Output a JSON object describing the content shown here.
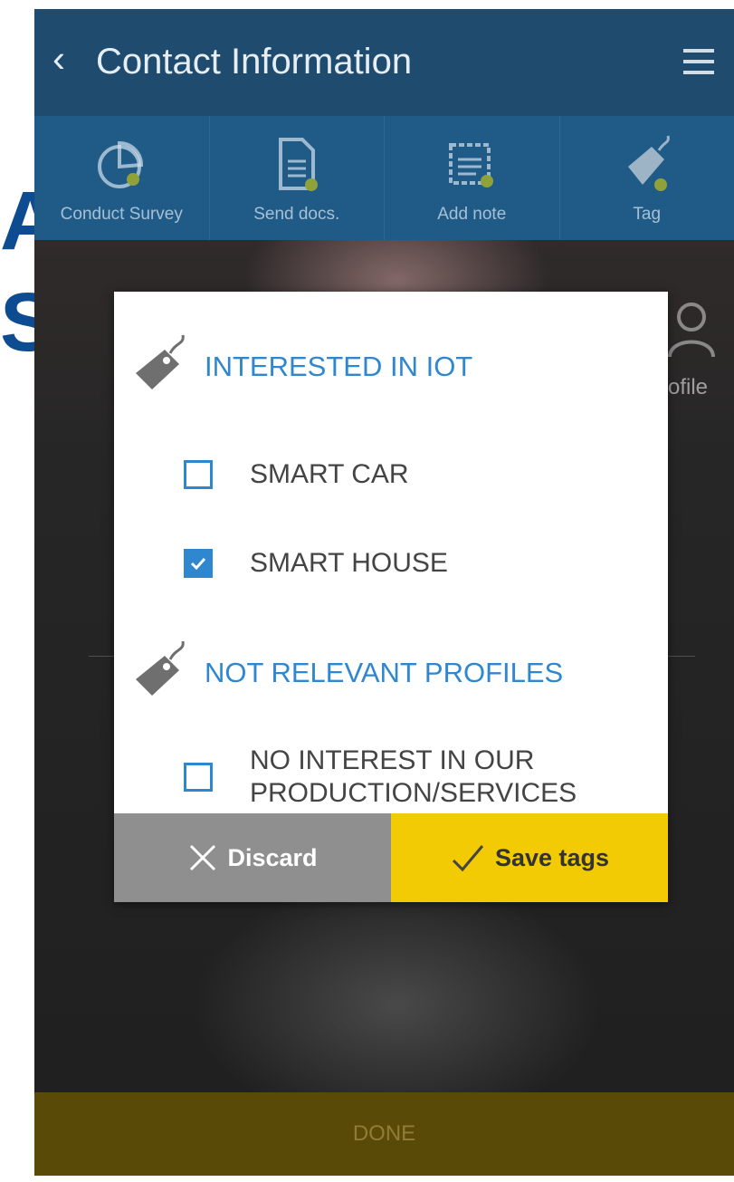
{
  "background_slide": {
    "letters": [
      "A",
      "S"
    ]
  },
  "header": {
    "back_icon": "chevron-left-icon",
    "title": "Contact Information",
    "menu_icon": "hamburger-menu-icon"
  },
  "toolbar": {
    "items": [
      {
        "label": "Conduct Survey",
        "icon": "survey-chart-icon"
      },
      {
        "label": "Send docs.",
        "icon": "document-icon"
      },
      {
        "label": "Add note",
        "icon": "note-icon"
      },
      {
        "label": "Tag",
        "icon": "tag-icon"
      }
    ]
  },
  "profile": {
    "label": "ofile",
    "icon": "profile-icon"
  },
  "modal": {
    "groups": [
      {
        "title": "INTERESTED IN IOT",
        "icon": "tag-icon",
        "options": [
          {
            "label": "SMART CAR",
            "checked": false
          },
          {
            "label": "SMART HOUSE",
            "checked": true
          }
        ]
      },
      {
        "title": "NOT RELEVANT PROFILES",
        "icon": "tag-icon",
        "options": [
          {
            "label_line1": "NO INTEREST IN OUR",
            "label_line2": "PRODUCTION/SERVICES",
            "checked": false
          }
        ]
      }
    ],
    "discard_label": "Discard",
    "save_label": "Save tags"
  },
  "footer": {
    "done_label": "DONE"
  },
  "colors": {
    "header": "#1e4b6e",
    "toolbar": "#1f5b86",
    "accent": "#2f87d0",
    "save": "#f2cb05",
    "discard": "#8f8f8f"
  }
}
